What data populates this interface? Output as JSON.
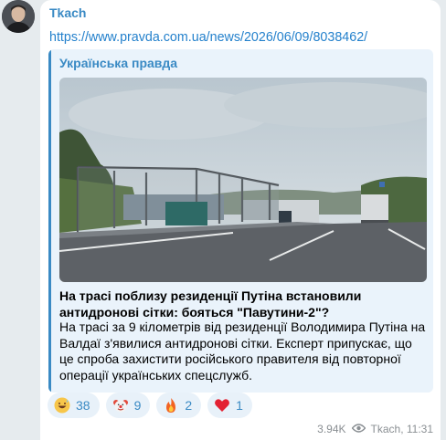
{
  "message": {
    "author": "Tkach",
    "link": "https://www.pravda.com.ua/news/2026/06/09/8038462/"
  },
  "preview": {
    "site_name": "Українська правда",
    "title": "На трасі поблизу резиденції Путіна встановили антидронові сітки: бояться \"Павутини-2\"?",
    "description": "На трасі за 9 кілометрів від резиденції Володимира Путіна на Валдаї з'явилися антидронові сітки. Експерт припускає, що це спроба захистити російського правителя від повторної операції українських спецслужб."
  },
  "reactions": [
    {
      "emoji": "grinning-sweat",
      "count": "38"
    },
    {
      "emoji": "clown",
      "count": "9"
    },
    {
      "emoji": "fire",
      "count": "2"
    },
    {
      "emoji": "red-heart",
      "count": "1"
    }
  ],
  "meta": {
    "views": "3.94K",
    "signature": "Tkach, 11:31"
  }
}
